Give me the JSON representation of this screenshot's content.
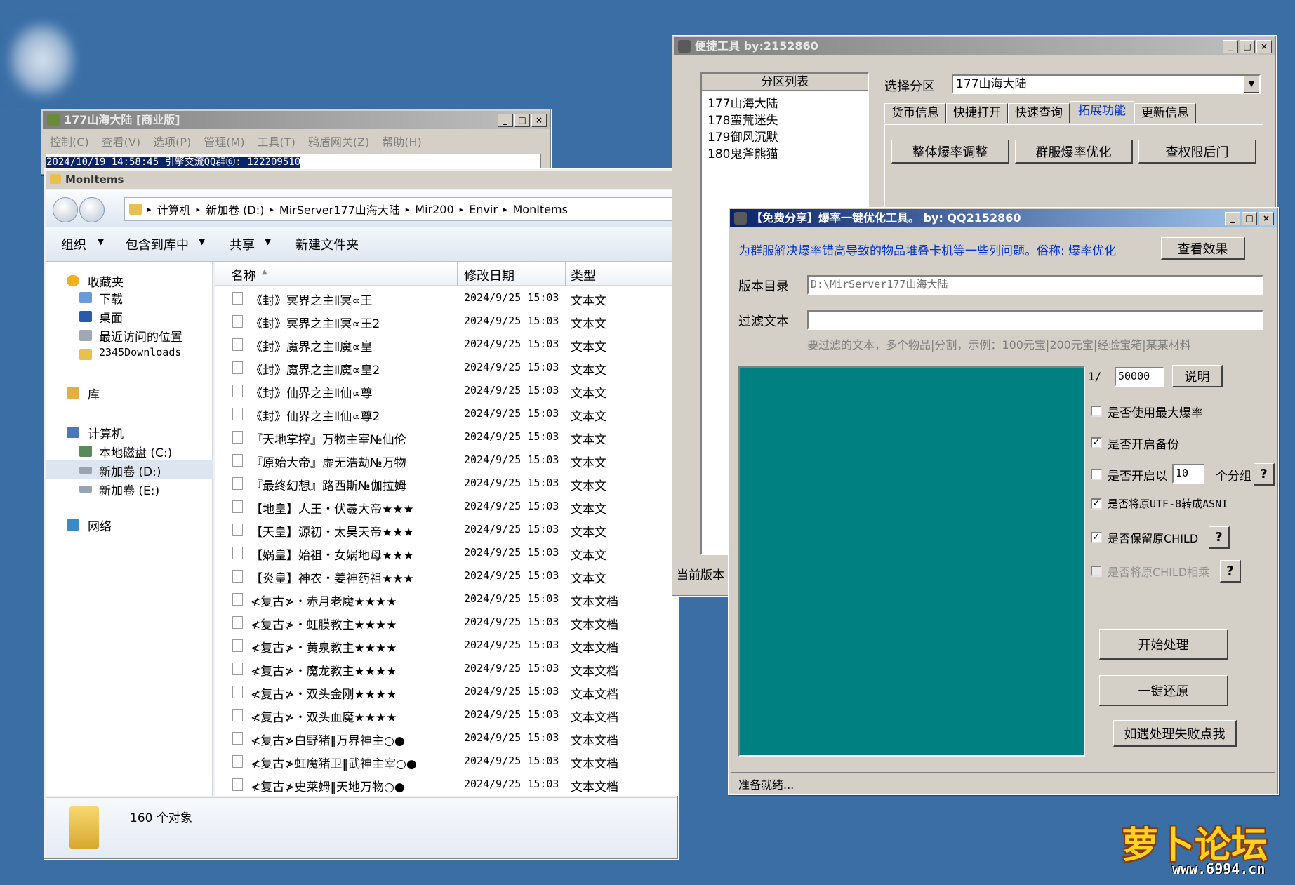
{
  "desktop": {
    "watermark": "萝卜论坛",
    "watermark_url": "www.6994.cn"
  },
  "console": {
    "title": "177山海大陆 [商业版]",
    "menu": [
      "控制(C)",
      "查看(V)",
      "选项(P)",
      "管理(M)",
      "工具(T)",
      "鸦盾网关(Z)",
      "帮助(H)"
    ],
    "log_line": "2024/10/19 14:58:45 引擎交流QQ群⑥: 122209510"
  },
  "explorer": {
    "title": "MonItems",
    "breadcrumb": [
      "计算机",
      "新加卷 (D:)",
      "MirServer177山海大陆",
      "Mir200",
      "Envir",
      "MonItems"
    ],
    "toolbar": [
      "组织",
      "包含到库中",
      "共享",
      "新建文件夹"
    ],
    "columns": {
      "name": "名称",
      "date": "修改日期",
      "type": "类型"
    },
    "nav": {
      "favorites": "收藏夹",
      "fav_items": [
        "下载",
        "桌面",
        "最近访问的位置",
        "2345Downloads"
      ],
      "library": "库",
      "computer": "计算机",
      "drives": [
        "本地磁盘 (C:)",
        "新加卷 (D:)",
        "新加卷 (E:)"
      ],
      "network": "网络"
    },
    "files": [
      {
        "name": "《封》冥界之主Ⅱ冥∝王",
        "date": "2024/9/25 15:03",
        "type": "文本文"
      },
      {
        "name": "《封》冥界之主Ⅱ冥∝王2",
        "date": "2024/9/25 15:03",
        "type": "文本文"
      },
      {
        "name": "《封》魔界之主Ⅱ魔∝皇",
        "date": "2024/9/25 15:03",
        "type": "文本文"
      },
      {
        "name": "《封》魔界之主Ⅱ魔∝皇2",
        "date": "2024/9/25 15:03",
        "type": "文本文"
      },
      {
        "name": "《封》仙界之主Ⅱ仙∝尊",
        "date": "2024/9/25 15:03",
        "type": "文本文"
      },
      {
        "name": "《封》仙界之主Ⅱ仙∝尊2",
        "date": "2024/9/25 15:03",
        "type": "文本文"
      },
      {
        "name": "『天地掌控』万物主宰№仙伦",
        "date": "2024/9/25 15:03",
        "type": "文本文"
      },
      {
        "name": "『原始大帝』虚无浩劫№万物",
        "date": "2024/9/25 15:03",
        "type": "文本文"
      },
      {
        "name": "『最终幻想』路西斯№伽拉姆",
        "date": "2024/9/25 15:03",
        "type": "文本文"
      },
      {
        "name": "【地皇】人王・伏羲大帝★★★",
        "date": "2024/9/25 15:03",
        "type": "文本文"
      },
      {
        "name": "【天皇】源初・太昊天帝★★★",
        "date": "2024/9/25 15:03",
        "type": "文本文"
      },
      {
        "name": "【娲皇】始祖・女娲地母★★★",
        "date": "2024/9/25 15:03",
        "type": "文本文"
      },
      {
        "name": "【炎皇】神农・姜神药祖★★★",
        "date": "2024/9/25 15:03",
        "type": "文本文"
      },
      {
        "name": "≮复古≯・赤月老魔★★★★",
        "date": "2024/9/25 15:03",
        "type": "文本文档"
      },
      {
        "name": "≮复古≯・虹膜教主★★★★",
        "date": "2024/9/25 15:03",
        "type": "文本文档"
      },
      {
        "name": "≮复古≯・黄泉教主★★★★",
        "date": "2024/9/25 15:03",
        "type": "文本文档"
      },
      {
        "name": "≮复古≯・魔龙教主★★★★",
        "date": "2024/9/25 15:03",
        "type": "文本文档"
      },
      {
        "name": "≮复古≯・双头金刚★★★★",
        "date": "2024/9/25 15:03",
        "type": "文本文档"
      },
      {
        "name": "≮复古≯・双头血魔★★★★",
        "date": "2024/9/25 15:03",
        "type": "文本文档"
      },
      {
        "name": "≮复古≯白野猪‖万界神主○●",
        "date": "2024/9/25 15:03",
        "type": "文本文档"
      },
      {
        "name": "≮复古≯虹魔猪卫‖武神主宰○●",
        "date": "2024/9/25 15:03",
        "type": "文本文档"
      },
      {
        "name": "≮复古≯史莱姆‖天地万物○●",
        "date": "2024/9/25 15:03",
        "type": "文本文档"
      }
    ],
    "status": "160 个对象"
  },
  "quicktool": {
    "title": "便捷工具  by:2152860",
    "partition_header": "分区列表",
    "partitions": [
      "177山海大陆",
      "178蛮荒迷失",
      "179御风沉默",
      "180鬼斧熊猫"
    ],
    "select_label": "选择分区",
    "select_value": "177山海大陆",
    "tabs": [
      "货币信息",
      "快捷打开",
      "快速查询",
      "拓展功能",
      "更新信息"
    ],
    "buttons": [
      "整体爆率调整",
      "群服爆率优化",
      "查权限后门"
    ],
    "current_version": "当前版本"
  },
  "optimizer": {
    "title": "【免费分享】爆率一键优化工具。  by: QQ2152860",
    "desc": "为群服解决爆率错高导致的物品堆叠卡机等一些列问题。俗称: 爆率优化",
    "view_btn": "查看效果",
    "dir_label": "版本目录",
    "dir_value": "D:\\MirServer177山海大陆",
    "filter_label": "过滤文本",
    "filter_value": "",
    "filter_hint": "要过滤的文本，多个物品|分割，示例：100元宝|200元宝|经验宝箱|某某材料",
    "ratio_prefix": "1/",
    "ratio_value": "50000",
    "explain_btn": "说明",
    "options": [
      {
        "label": "是否使用最大爆率",
        "checked": false
      },
      {
        "label": "是否开启备份",
        "checked": true
      },
      {
        "label": "是否开启以",
        "checked": false,
        "count": "10",
        "suffix": "个分组"
      },
      {
        "label": "是否将原UTF-8转成ASNI",
        "checked": true
      },
      {
        "label": "是否保留原CHILD",
        "checked": true
      },
      {
        "label": "是否将原CHILD相乘",
        "checked": false
      }
    ],
    "help": "?",
    "start_btn": "开始处理",
    "restore_btn": "一键还原",
    "fail_btn": "如遇处理失败点我",
    "status": "准备就绪..."
  }
}
